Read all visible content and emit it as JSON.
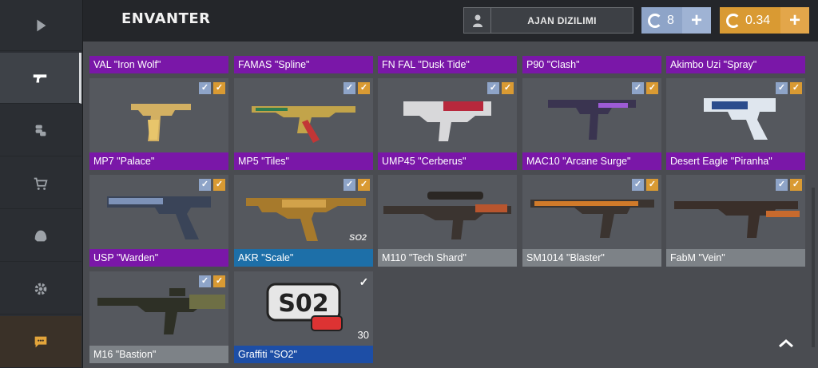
{
  "header": {
    "title": "ENVANTER",
    "agent_label": "AJAN DIZILIMI",
    "currency_blue": "8",
    "currency_gold": "0.34",
    "plus": "+"
  },
  "sidebar": {
    "items": [
      {
        "icon": "play-icon"
      },
      {
        "icon": "pistol-icon"
      },
      {
        "icon": "coins-icon"
      },
      {
        "icon": "cart-icon"
      },
      {
        "icon": "helmet-icon"
      },
      {
        "icon": "gear-icon"
      },
      {
        "icon": "chat-icon"
      }
    ]
  },
  "top_row": [
    {
      "name": "VAL \"Iron Wolf\"",
      "rarity": "purple"
    },
    {
      "name": "FAMAS \"Spline\"",
      "rarity": "purple"
    },
    {
      "name": "FN FAL \"Dusk Tide\"",
      "rarity": "purple"
    },
    {
      "name": "P90 \"Clash\"",
      "rarity": "purple"
    },
    {
      "name": "Akimbo Uzi \"Spray\"",
      "rarity": "purple"
    }
  ],
  "items": [
    {
      "name": "MP7 \"Palace\"",
      "rarity": "purple",
      "checks": [
        "blue",
        "gold"
      ]
    },
    {
      "name": "MP5 \"Tiles\"",
      "rarity": "purple",
      "checks": [
        "blue",
        "gold"
      ]
    },
    {
      "name": "UMP45 \"Cerberus\"",
      "rarity": "purple",
      "checks": [
        "blue",
        "gold"
      ]
    },
    {
      "name": "MAC10 \"Arcane Surge\"",
      "rarity": "purple",
      "checks": [
        "blue",
        "gold"
      ]
    },
    {
      "name": "Desert Eagle \"Piranha\"",
      "rarity": "purple",
      "checks": [
        "blue",
        "gold"
      ]
    },
    {
      "name": "USP \"Warden\"",
      "rarity": "purple",
      "checks": [
        "blue",
        "gold"
      ]
    },
    {
      "name": "AKR \"Scale\"",
      "rarity": "blue",
      "checks": [
        "blue",
        "gold"
      ],
      "tag": "SO2"
    },
    {
      "name": "M110 \"Tech Shard\"",
      "rarity": "gray",
      "checks": []
    },
    {
      "name": "SM1014 \"Blaster\"",
      "rarity": "gray",
      "checks": [
        "blue",
        "gold"
      ]
    },
    {
      "name": "FabM \"Vein\"",
      "rarity": "gray",
      "checks": [
        "blue",
        "gold"
      ]
    },
    {
      "name": "M16 \"Bastion\"",
      "rarity": "gray",
      "checks": [
        "blue",
        "gold"
      ]
    },
    {
      "name": "Graffiti \"SO2\"",
      "rarity": "navy",
      "checks": [
        "white"
      ],
      "count": "30"
    }
  ],
  "colors": {
    "purple": "#7a17a8",
    "blue": "#1d6fa8",
    "gray": "#7d8287",
    "navy": "#1d4ea6",
    "gold": "#d99a33",
    "silver_blue": "#8ea4c8"
  }
}
